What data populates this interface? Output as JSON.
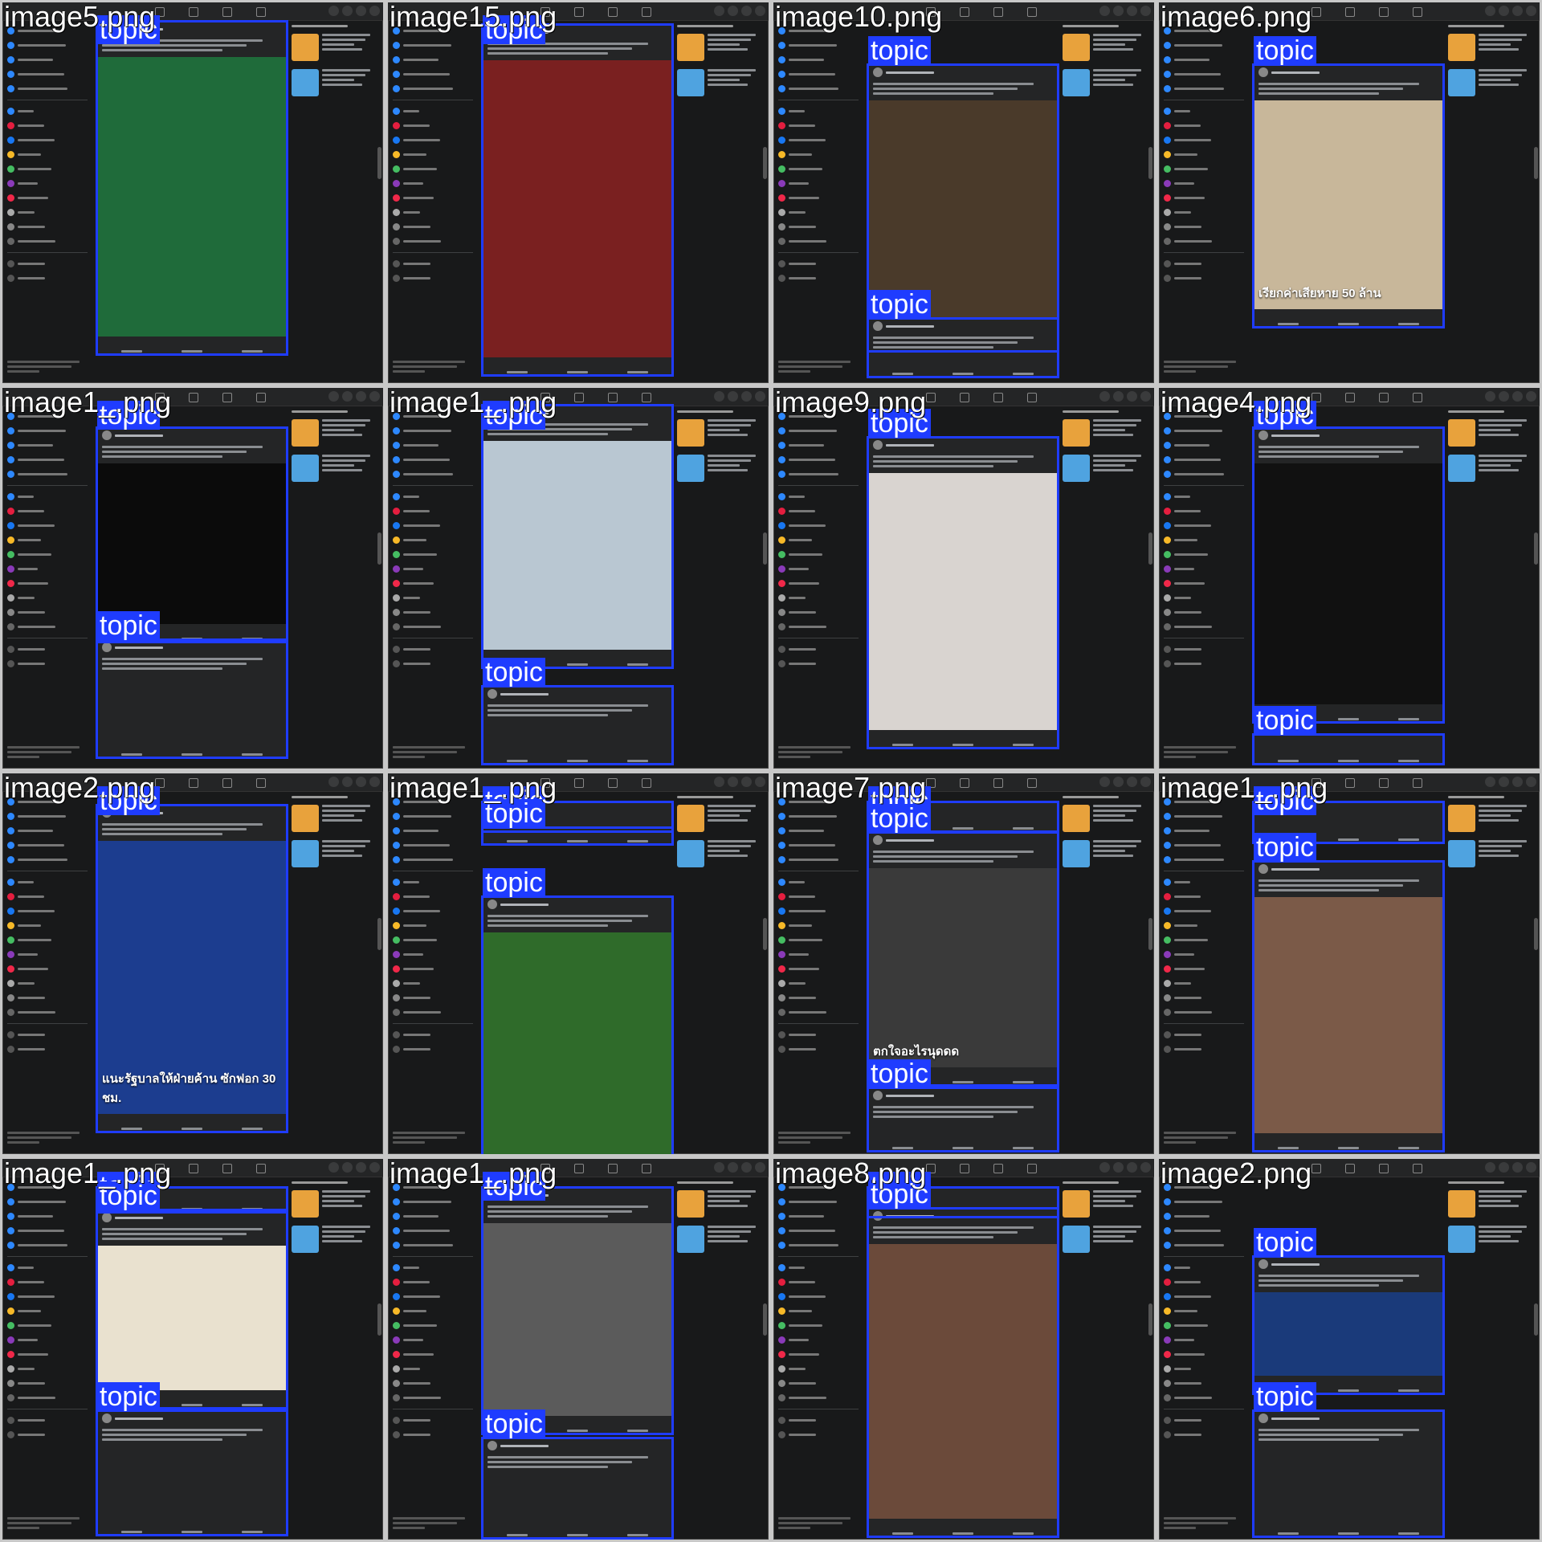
{
  "colors": {
    "bbox": "#1f3cff",
    "feed_bg": "#18191a",
    "card_bg": "#242526"
  },
  "tag_label": "topic",
  "tiles": [
    {
      "file": "image5.png",
      "media": "#1f6b3a",
      "caption": "",
      "tags": 2
    },
    {
      "file": "image15.png",
      "media": "#7a2020",
      "caption": "",
      "tags": 2
    },
    {
      "file": "image10.png",
      "media": "#4a3a2a",
      "caption": "",
      "tags": 2
    },
    {
      "file": "image6.png",
      "media": "#c8b79a",
      "caption": "เรียกค่าเสียหาย 50 ล้าน",
      "tags": 1
    },
    {
      "file": "image1_.png",
      "media": "#0b0b0b",
      "caption": "",
      "tags": 2
    },
    {
      "file": "image1_.png",
      "media": "#b9c7d2",
      "caption": "",
      "tags": 2
    },
    {
      "file": "image9.png",
      "media": "#d9d4d0",
      "caption": "",
      "tags": 1
    },
    {
      "file": "image4.png",
      "media": "#111111",
      "caption": "",
      "tags": 1
    },
    {
      "file": "image2.png",
      "media": "#1c3d8f",
      "caption": "แนะรัฐบาลให้ฝ่ายค้าน ซักฟอก 30 ชม.",
      "tags": 1
    },
    {
      "file": "image1_.png",
      "media": "#2f6b2a",
      "caption": "",
      "tags": 3
    },
    {
      "file": "image7.png",
      "media": "#3a3a3a",
      "caption": "ตกใจอะไรนุดดด",
      "tags": 3
    },
    {
      "file": "image1_.png",
      "media": "#7b5a48",
      "caption": "",
      "tags": 2
    },
    {
      "file": "image1_.png",
      "media": "#e9e1cf",
      "caption": "",
      "tags": 3
    },
    {
      "file": "image1_.png",
      "media": "#5b5b5b",
      "caption": "",
      "tags": 2
    },
    {
      "file": "image8.png",
      "media": "#6b4a3a",
      "caption": "",
      "tags": 2
    },
    {
      "file": "image2.png",
      "media": "#1a3a7a",
      "caption": "",
      "tags": 2
    }
  ]
}
